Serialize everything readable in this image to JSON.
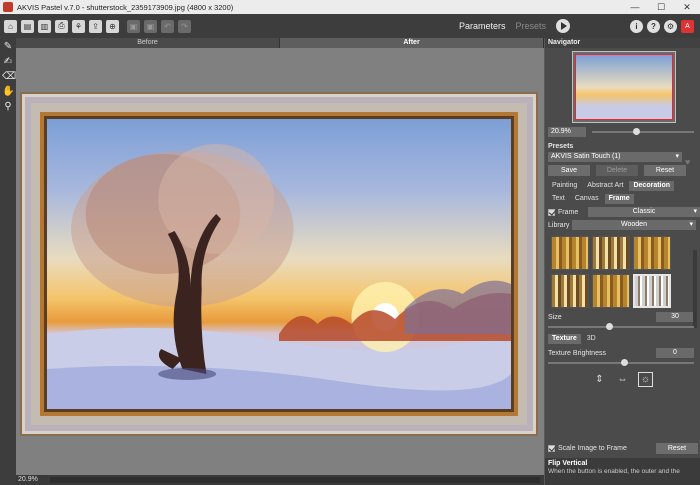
{
  "window": {
    "title": "AKVIS Pastel v.7.0 - shutterstock_2359173909.jpg (4800 x 3200)",
    "minimize": "—",
    "maximize": "☐",
    "close": "✕"
  },
  "toolbar": {
    "mode_parameters": "Parameters",
    "mode_presets": "Presets",
    "info": "i",
    "help": "?",
    "settings": "⚙"
  },
  "canvas": {
    "tab_before": "Before",
    "tab_after": "After",
    "zoom": "20.9%"
  },
  "panel": {
    "navigator_title": "Navigator",
    "zoom_value": "20.9%",
    "presets_title": "Presets",
    "preset_selected": "AKVIS Satin Touch (1)",
    "save": "Save",
    "delete": "Delete",
    "reset": "Reset",
    "tabs": [
      "Painting",
      "Abstract Art",
      "Decoration"
    ],
    "subtabs": [
      "Text",
      "Canvas",
      "Frame"
    ],
    "frame_label": "Frame",
    "frame_type": "Classic",
    "library_label": "Library",
    "library_value": "Wooden",
    "size_label": "Size",
    "size_value": "30",
    "texture_tab": "Texture",
    "texture_3d": "3D",
    "texture_brightness_label": "Texture Brightness",
    "texture_brightness_value": "0",
    "scale_label": "Scale Image to Frame",
    "reset_bottom": "Reset",
    "help_title": "Flip Vertical",
    "help_text": "When the button is enabled, the outer and the"
  }
}
